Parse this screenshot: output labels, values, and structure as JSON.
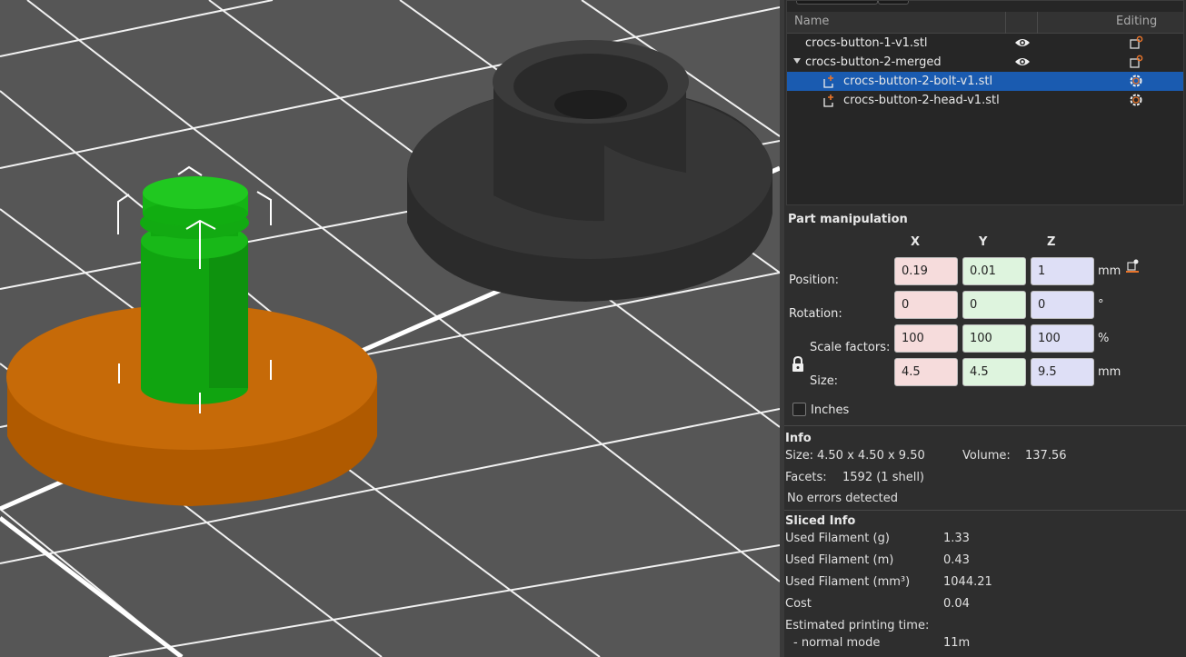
{
  "object_list": {
    "header": {
      "name": "Name",
      "editing": "Editing"
    },
    "items": [
      {
        "label": "crocs-button-1-v1.stl"
      },
      {
        "label": "crocs-button-2-merged"
      },
      {
        "label": "crocs-button-2-bolt-v1.stl"
      },
      {
        "label": "crocs-button-2-head-v1.stl"
      }
    ]
  },
  "part_manipulation": {
    "title": "Part manipulation",
    "axes": {
      "x": "X",
      "y": "Y",
      "z": "Z"
    },
    "position": {
      "label": "Position:",
      "x": "0.19",
      "y": "0.01",
      "z": "1",
      "unit": "mm"
    },
    "rotation": {
      "label": "Rotation:",
      "x": "0",
      "y": "0",
      "z": "0",
      "unit": "°"
    },
    "scale": {
      "label": "Scale factors:",
      "x": "100",
      "y": "100",
      "z": "100",
      "unit": "%"
    },
    "size": {
      "label": "Size:",
      "x": "4.5",
      "y": "4.5",
      "z": "9.5",
      "unit": "mm"
    },
    "inches_label": "Inches"
  },
  "info": {
    "title": "Info",
    "size_label": "Size:",
    "size_value": "4.50 x 4.50 x 9.50",
    "volume_label": "Volume:",
    "volume_value": "137.56",
    "facets_label": "Facets:",
    "facets_value": "1592 (1 shell)",
    "errors": "No errors detected"
  },
  "sliced_info": {
    "title": "Sliced Info",
    "rows": [
      {
        "label": "Used Filament (g)",
        "value": "1.33"
      },
      {
        "label": "Used Filament (m)",
        "value": "0.43"
      },
      {
        "label": "Used Filament (mm³)",
        "value": "1044.21"
      },
      {
        "label": "Cost",
        "value": "0.04"
      }
    ],
    "print_time_label": "Estimated printing time:",
    "normal_mode_label": "- normal mode",
    "normal_mode_value": "11m"
  },
  "colors": {
    "selection": "#1a5bb0",
    "accent": "#e8742b",
    "part_green": "#12b812",
    "part_orange": "#c06400",
    "object_dark": "#2f2f2f"
  }
}
